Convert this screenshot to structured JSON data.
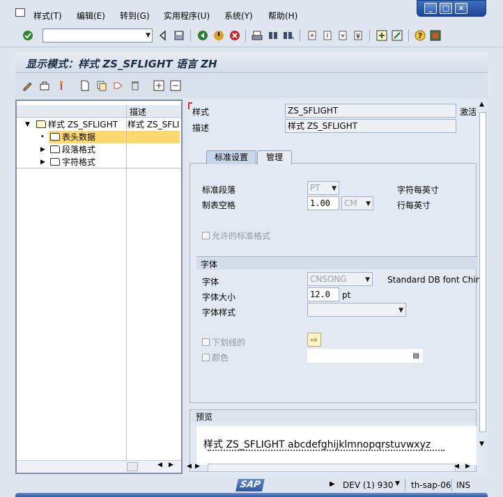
{
  "menubar": {
    "items": [
      {
        "label": "样式(T)"
      },
      {
        "label": "编辑(E)"
      },
      {
        "label": "转到(G)"
      },
      {
        "label": "实用程序(U)"
      },
      {
        "label": "系统(Y)"
      },
      {
        "label": "帮助(H)"
      }
    ]
  },
  "command_field": {
    "value": ""
  },
  "title": "显示模式：样式 ZS_SFLIGHT 语言 ZH",
  "tree": {
    "header": {
      "col2": "描述"
    },
    "root": {
      "label": "样式 ZS_SFLIGHT",
      "desc": "样式 ZS_SFLI"
    },
    "children": [
      {
        "label": "表头数据",
        "selected": true
      },
      {
        "label": "段落格式",
        "selected": false
      },
      {
        "label": "字符格式",
        "selected": false
      }
    ]
  },
  "header_fields": {
    "style_label": "样式",
    "style_value": "ZS_SFLIGHT",
    "status_text": "激活",
    "desc_label": "描述",
    "desc_value": "样式 ZS_SFLIGHT"
  },
  "tabs": [
    {
      "label": "标准设置",
      "active": true
    },
    {
      "label": "管理",
      "active": false
    }
  ],
  "standard": {
    "para_label": "标准段落",
    "para_value": "PT",
    "tab_label": "制表空格",
    "tab_value": "1.00",
    "tab_unit": "CM",
    "cpi_label": "字符每英寸",
    "lpi_label": "行每英寸",
    "allowed_formats_label": "允许的标准格式"
  },
  "font_group": {
    "title": "字体",
    "family_label": "字体",
    "family_value": "CNSONG",
    "family_desc": "Standard DB font China",
    "size_label": "字体大小",
    "size_value": "12.0",
    "size_unit": "pt",
    "style_label": "字体样式",
    "style_value": "",
    "underline_label": "下划线的",
    "color_label": "颜色",
    "color_value": ""
  },
  "preview": {
    "title": "预览",
    "line1": "样式  ZS_SFLIGHT abcdefghijklmnopqrstuvwxyz"
  },
  "status": {
    "system": "DEV (1) 930",
    "host": "th-sap-06",
    "mode": "INS"
  },
  "colors": {
    "selected_row": "#ffd86e",
    "title_text": "#1b2c44",
    "window_frame": "#2d5fb8"
  }
}
